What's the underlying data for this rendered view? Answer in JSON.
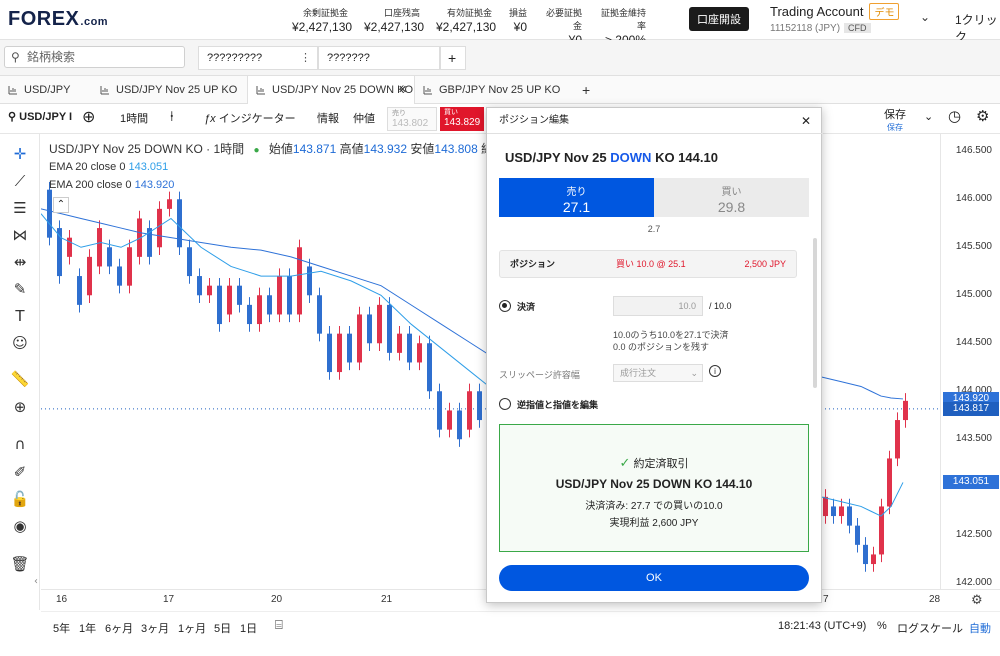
{
  "brand": {
    "logo_main": "FOREX",
    "logo_suffix": ".com"
  },
  "account_stats": [
    {
      "label": "余剰証拠金",
      "value": "¥2,427,130"
    },
    {
      "label": "口座残高",
      "value": "¥2,427,130"
    },
    {
      "label": "有効証拠金",
      "value": "¥2,427,130"
    },
    {
      "label": "損益",
      "value": "¥0"
    },
    {
      "label": "必要証拠金",
      "value": "¥0"
    },
    {
      "label": "証拠金維持率",
      "value": "> 200%"
    }
  ],
  "open_account_label": "口座開設",
  "account": {
    "name": "Trading Account",
    "badge": "デモ",
    "id": "11152118 (JPY)",
    "type": "CFD"
  },
  "one_click_label": "1クリック",
  "search": {
    "placeholder": "銘柄検索"
  },
  "watchlists": [
    "?????????",
    "???????"
  ],
  "add_label": "+",
  "tabs": [
    {
      "label": "USD/JPY"
    },
    {
      "label": "USD/JPY Nov 25 UP KO"
    },
    {
      "label": "USD/JPY Nov 25 DOWN KO",
      "active": true
    },
    {
      "label": "GBP/JPY Nov 25 UP KO"
    }
  ],
  "toolbar": {
    "symbol": "USD/JPY I",
    "interval": "1時間",
    "indicators": "インジケーター",
    "info": "情報",
    "mid": "仲値",
    "sell_label": "売り",
    "sell_price": "143.802",
    "buy_label": "買い",
    "buy_price": "143.829",
    "save": "保存",
    "save_sub": "保存"
  },
  "chart_legend": {
    "title": "USD/JPY Nov 25 DOWN KO · 1時間",
    "open_label": "始値",
    "open": "143.871",
    "high_label": "高値",
    "high": "143.932",
    "low_label": "安値",
    "low": "143.808",
    "close_label": "終値",
    "ema20_label": "EMA 20 close 0",
    "ema20": "143.051",
    "ema200_label": "EMA 200 close 0",
    "ema200": "143.920"
  },
  "chart_data": {
    "type": "candlestick",
    "y_ticks": [
      "146.500",
      "146.000",
      "145.500",
      "145.000",
      "144.500",
      "144.000",
      "143.500",
      "143.000",
      "142.500",
      "142.000"
    ],
    "ylim": [
      141.94,
      146.68
    ],
    "x_ticks": [
      "16",
      "17",
      "20",
      "21",
      "7",
      "28"
    ],
    "price_labels": [
      {
        "value": "143.920",
        "color": "#2e72d8"
      },
      {
        "value": "143.817",
        "color": "#1f5fbf"
      },
      {
        "value": "143.051",
        "color": "#2e72d8"
      }
    ],
    "ema200": [
      145.9,
      145.85,
      145.8,
      145.75,
      145.7,
      145.65,
      145.6,
      145.55,
      145.5,
      145.47,
      145.4,
      145.3,
      145.2,
      145.1,
      144.9,
      144.7,
      144.5,
      144.3,
      144.18,
      144.15,
      144.1,
      144.05,
      144.0,
      143.95,
      143.93,
      143.92
    ],
    "ema20": [
      145.85,
      145.6,
      145.5,
      145.55,
      145.5,
      145.6,
      145.8,
      145.5,
      145.3,
      145.2,
      145.2,
      145.25,
      145.15,
      145.0,
      144.7,
      144.45,
      144.2,
      143.95,
      143.8,
      142.9,
      142.85,
      142.8,
      142.75,
      142.7,
      142.8,
      143.05
    ],
    "ema_x": [
      0,
      20,
      40,
      60,
      80,
      100,
      130,
      160,
      190,
      220,
      250,
      280,
      310,
      340,
      370,
      400,
      430,
      460,
      480,
      780,
      800,
      820,
      830,
      840,
      850,
      862
    ],
    "candles": [
      [
        146.1,
        145.6
      ],
      [
        145.7,
        145.2
      ],
      [
        145.4,
        145.6
      ],
      [
        145.2,
        144.9
      ],
      [
        145.0,
        145.4
      ],
      [
        145.3,
        145.7
      ],
      [
        145.5,
        145.3
      ],
      [
        145.3,
        145.1
      ],
      [
        145.1,
        145.5
      ],
      [
        145.4,
        145.8
      ],
      [
        145.7,
        145.4
      ],
      [
        145.5,
        145.9
      ],
      [
        145.9,
        146.0
      ],
      [
        146.0,
        145.5
      ],
      [
        145.5,
        145.2
      ],
      [
        145.2,
        145.0
      ],
      [
        145.0,
        145.1
      ],
      [
        145.1,
        144.7
      ],
      [
        144.8,
        145.1
      ],
      [
        145.1,
        144.9
      ],
      [
        144.9,
        144.7
      ],
      [
        144.7,
        145.0
      ],
      [
        145.0,
        144.8
      ],
      [
        144.8,
        145.2
      ],
      [
        145.2,
        144.8
      ],
      [
        144.8,
        145.5
      ],
      [
        145.3,
        145.0
      ],
      [
        145.0,
        144.6
      ],
      [
        144.6,
        144.2
      ],
      [
        144.2,
        144.6
      ],
      [
        144.6,
        144.3
      ],
      [
        144.3,
        144.8
      ],
      [
        144.8,
        144.5
      ],
      [
        144.5,
        144.9
      ],
      [
        144.9,
        144.4
      ],
      [
        144.4,
        144.6
      ],
      [
        144.6,
        144.3
      ],
      [
        144.3,
        144.5
      ],
      [
        144.5,
        144.0
      ],
      [
        144.0,
        143.6
      ],
      [
        143.6,
        143.8
      ],
      [
        143.8,
        143.5
      ],
      [
        143.6,
        144.0
      ],
      [
        144.0,
        143.7
      ]
    ],
    "candles_right": [
      [
        142.7,
        142.9
      ],
      [
        142.8,
        142.7
      ],
      [
        142.7,
        142.8
      ],
      [
        142.8,
        142.6
      ],
      [
        142.6,
        142.4
      ],
      [
        142.4,
        142.2
      ],
      [
        142.2,
        142.3
      ],
      [
        142.3,
        142.8
      ],
      [
        142.8,
        143.3
      ],
      [
        143.3,
        143.7
      ],
      [
        143.7,
        143.9
      ]
    ],
    "up_color": "#e0324b",
    "down_color": "#2f6fcf"
  },
  "left_tools": [
    "crosshair-icon",
    "trendline-icon",
    "fib-icon",
    "pattern-icon",
    "measure-tool-icon",
    "brush-icon",
    "text-icon",
    "emoji-icon",
    "ruler-icon",
    "zoom-in-icon",
    "magnet-icon",
    "lock-draw-icon",
    "lock-icon",
    "eye-icon",
    "trash-icon"
  ],
  "bottom_bar": {
    "ranges": [
      "5年",
      "1年",
      "6ヶ月",
      "3ヶ月",
      "1ヶ月",
      "5日",
      "1日"
    ],
    "time": "18:21:43 (UTC+9)",
    "percent": "%",
    "log": "ログスケール",
    "auto": "自動"
  },
  "modal": {
    "header": "ポジション編集",
    "title_prefix": "USD/JPY Nov 25",
    "title_dir": "DOWN",
    "title_suffix": "KO 144.10",
    "sell_label": "売り",
    "sell_price": "27.1",
    "buy_label": "買い",
    "buy_price": "29.8",
    "spread": "2.7",
    "position_label": "ポジション",
    "position_value": "買い 10.0 @ 25.1",
    "position_pl": "2,500 JPY",
    "close_label": "決済",
    "close_qty": "10.0",
    "close_total": "/ 10.0",
    "close_desc1": "10.0のうち10.0を27.1で決済",
    "close_desc2": "0.0 のポジションを残す",
    "slippage_label": "スリッページ許容幅",
    "slippage_select": "成行注文",
    "stop_limit_label": "逆指値と指値を編集",
    "success_head": "約定済取引",
    "success_title": "USD/JPY Nov 25 DOWN KO 144.10",
    "success_line1": "決済済み: 27.7 での買いの10.0",
    "success_line2": "実現利益 2,600 JPY",
    "ok_label": "OK"
  }
}
